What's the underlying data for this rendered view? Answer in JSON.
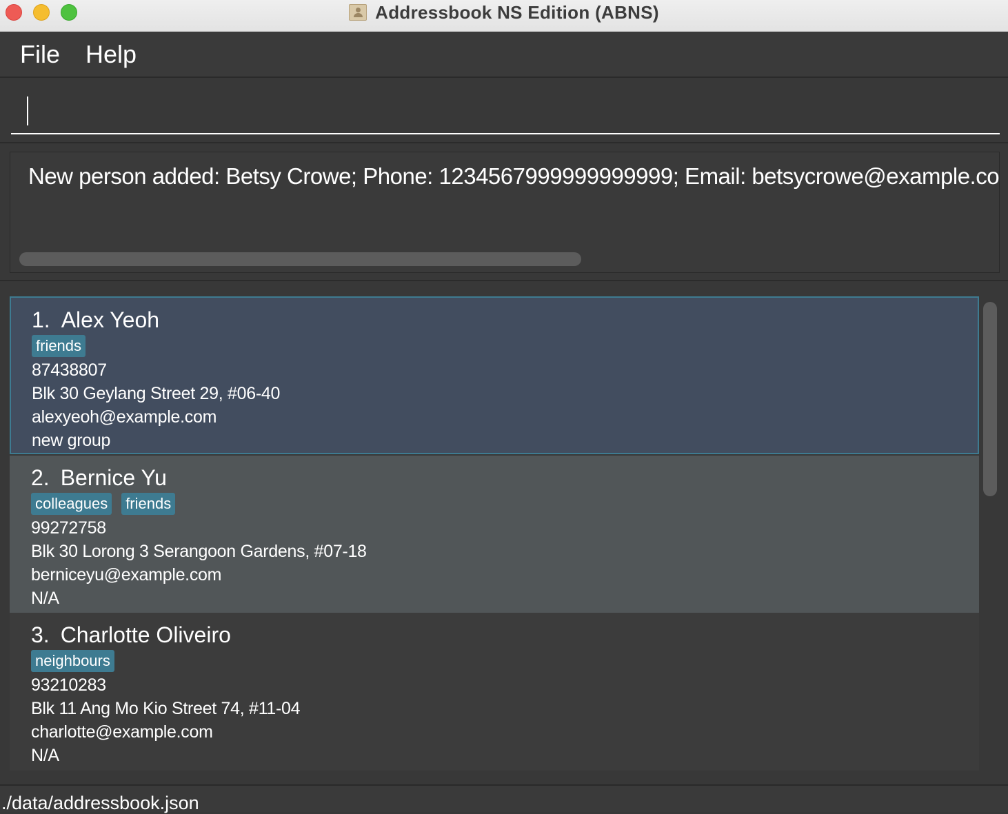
{
  "window": {
    "title": "Addressbook NS Edition (ABNS)"
  },
  "menu": {
    "file": "File",
    "help": "Help"
  },
  "command": {
    "value": ""
  },
  "result": {
    "text": "New person added: Betsy Crowe; Phone: 1234567999999999999; Email: betsycrowe@example.com"
  },
  "persons": [
    {
      "index": "1.",
      "name": "Alex Yeoh",
      "tags": [
        "friends"
      ],
      "phone": "87438807",
      "address": "Blk 30 Geylang Street 29, #06-40",
      "email": "alexyeoh@example.com",
      "group": "new group"
    },
    {
      "index": "2.",
      "name": "Bernice Yu",
      "tags": [
        "colleagues",
        "friends"
      ],
      "phone": "99272758",
      "address": "Blk 30 Lorong 3 Serangoon Gardens, #07-18",
      "email": "berniceyu@example.com",
      "group": "N/A"
    },
    {
      "index": "3.",
      "name": "Charlotte Oliveiro",
      "tags": [
        "neighbours"
      ],
      "phone": "93210283",
      "address": "Blk 11 Ang Mo Kio Street 74, #11-04",
      "email": "charlotte@example.com",
      "group": "N/A"
    }
  ],
  "status": {
    "path": "./data/addressbook.json"
  },
  "colors": {
    "background": "#383838",
    "selected_card": "#424d5f",
    "selected_border": "#3e7b91",
    "tag": "#3e7b91",
    "odd_card": "#515658"
  }
}
